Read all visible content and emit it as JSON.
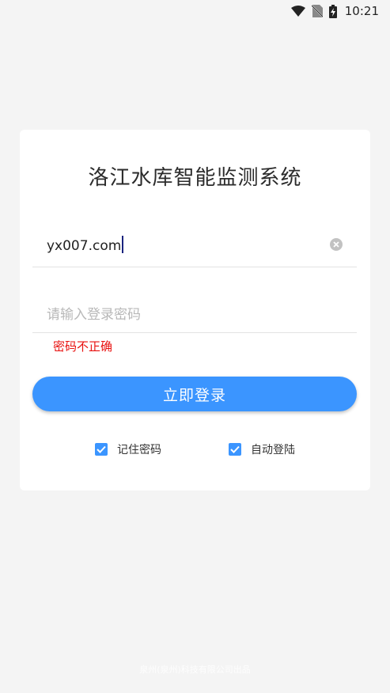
{
  "status_bar": {
    "time": "10:21",
    "icons": [
      "wifi-icon",
      "no-sim-icon",
      "battery-charging-icon"
    ]
  },
  "login": {
    "title": "洛江水库智能监测系统",
    "username": {
      "value": "yx007.com"
    },
    "password": {
      "placeholder": "请输入登录密码"
    },
    "error": "密码不正确",
    "submit_label": "立即登录",
    "remember_password": {
      "label": "记住密码",
      "checked": true
    },
    "auto_login": {
      "label": "自动登陆",
      "checked": true
    }
  },
  "footer": {
    "text": "泉州(泉州)科技有限公司出品"
  },
  "colors": {
    "accent": "#3b95ff",
    "error": "#e8110f",
    "background": "#f4f4f4"
  }
}
